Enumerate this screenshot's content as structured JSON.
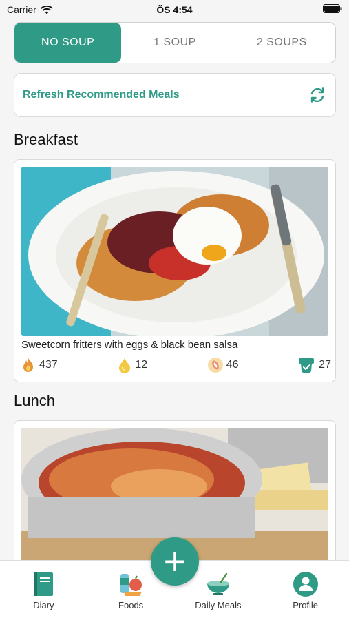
{
  "status": {
    "carrier": "Carrier",
    "time": "ÖS 4:54"
  },
  "soup_selector": {
    "options": [
      "NO SOUP",
      "1 SOUP",
      "2 SOUPS"
    ],
    "selected_index": 0
  },
  "refresh": {
    "label": "Refresh Recommended Meals",
    "icon": "refresh-icon"
  },
  "meals": [
    {
      "section": "Breakfast",
      "name": "Sweetcorn fritters with eggs & black bean salsa",
      "nutrients": {
        "calories": "437",
        "fat": "12",
        "carbs": "46",
        "protein": "27"
      }
    },
    {
      "section": "Lunch",
      "name": "",
      "nutrients": {}
    }
  ],
  "tabs": [
    {
      "label": "Diary",
      "icon": "diary-icon"
    },
    {
      "label": "Foods",
      "icon": "foods-icon"
    },
    {
      "label": "Daily Meals",
      "icon": "daily-meals-icon"
    },
    {
      "label": "Profile",
      "icon": "profile-icon"
    }
  ],
  "fab": {
    "label": "+"
  },
  "colors": {
    "accent": "#2f9b87",
    "background": "#f5f5f5"
  }
}
